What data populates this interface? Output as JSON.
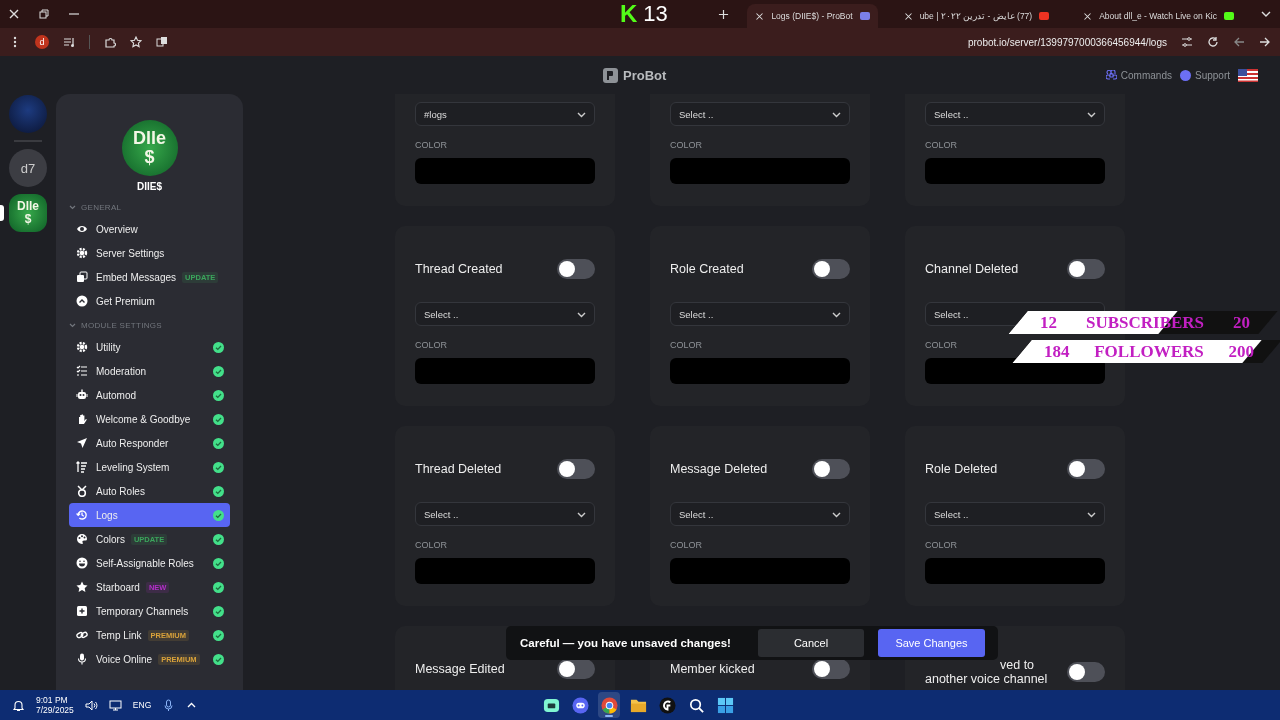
{
  "kick_overlay": {
    "logo": "K",
    "count": "13"
  },
  "tabs": [
    {
      "title": "Logs (DIIE$) - ProBot",
      "selected": true
    },
    {
      "title": "(77) عايض - تدرين ٢٠٢٢ | ube",
      "selected": false
    },
    {
      "title": "About dll_e - Watch Live on Kic",
      "selected": false
    }
  ],
  "toolbar": {
    "profile_initial": "d",
    "url": "probot.io/server/1399797000366456944/logs"
  },
  "header": {
    "brand": "ProBot",
    "links": [
      "Commands",
      "Support"
    ]
  },
  "servers": [
    {
      "kind": "photo",
      "selected": false
    },
    {
      "kind": "initials",
      "label": "d7",
      "selected": false
    },
    {
      "kind": "logo",
      "label": "Dlle $",
      "selected": true
    }
  ],
  "server": {
    "logo_text": "Dlle $",
    "name": "DIIE$"
  },
  "sidebar": {
    "sections": [
      {
        "title": "GENERAL",
        "expanded": true,
        "items": [
          {
            "label": "Overview",
            "selected": false
          },
          {
            "label": "Server Settings",
            "selected": false
          },
          {
            "label": "Embed Messages",
            "badge": {
              "text": "UPDATE",
              "color": "#3ba55c"
            },
            "selected": false
          },
          {
            "label": "Get Premium",
            "selected": false
          }
        ]
      },
      {
        "title": "MODULE SETTINGS",
        "expanded": true,
        "items": [
          {
            "label": "Utility",
            "enabled": true,
            "selected": false
          },
          {
            "label": "Moderation",
            "enabled": true,
            "selected": false
          },
          {
            "label": "Automod",
            "enabled": true,
            "selected": false
          },
          {
            "label": "Welcome & Goodbye",
            "enabled": true,
            "selected": false
          },
          {
            "label": "Auto Responder",
            "enabled": true,
            "selected": false
          },
          {
            "label": "Leveling System",
            "enabled": true,
            "selected": false
          },
          {
            "label": "Auto Roles",
            "enabled": true,
            "selected": false
          },
          {
            "label": "Logs",
            "enabled": true,
            "selected": true
          },
          {
            "label": "Colors",
            "badge": {
              "text": "UPDATE",
              "color": "#3ba55c"
            },
            "enabled": true,
            "selected": false
          },
          {
            "label": "Self-Assignable Roles",
            "enabled": true,
            "selected": false
          },
          {
            "label": "Starboard",
            "badge": {
              "text": "NEW",
              "color": "#b22fc8"
            },
            "enabled": true,
            "selected": false
          },
          {
            "label": "Temporary Channels",
            "enabled": true,
            "selected": false
          },
          {
            "label": "Temp Link",
            "badge": {
              "text": "PREMIUM",
              "color": "#d9a23a"
            },
            "enabled": true,
            "selected": false
          },
          {
            "label": "Voice Online",
            "badge": {
              "text": "PREMIUM",
              "color": "#d9a23a"
            },
            "enabled": true,
            "selected": false
          }
        ]
      }
    ]
  },
  "log_cards": [
    {
      "channel": "#logs",
      "color_label": "COLOR"
    },
    {
      "channel": "Select ..",
      "color_label": "COLOR"
    },
    {
      "channel": "Select ..",
      "color_label": "COLOR"
    },
    {
      "title": "Thread Created",
      "on": false,
      "channel": "Select ..",
      "color_label": "COLOR"
    },
    {
      "title": "Role Created",
      "on": false,
      "channel": "Select ..",
      "color_label": "COLOR"
    },
    {
      "title": "Channel Deleted",
      "on": false,
      "channel": "Select ..",
      "color_label": "COLOR"
    },
    {
      "title": "Thread Deleted",
      "on": false,
      "channel": "Select ..",
      "color_label": "COLOR"
    },
    {
      "title": "Message Deleted",
      "on": false,
      "channel": "Select ..",
      "color_label": "COLOR"
    },
    {
      "title": "Role Deleted",
      "on": false,
      "channel": "Select ..",
      "color_label": "COLOR"
    },
    {
      "title": "Message Edited",
      "on": false
    },
    {
      "title": "Member kicked",
      "on": false
    },
    {
      "title": "ved to another voice channel",
      "on": false
    }
  ],
  "toast": {
    "message": "Careful — you have unsaved changes!",
    "buttons": [
      {
        "label": "Cancel",
        "kind": "secondary"
      },
      {
        "label": "Save Changes",
        "kind": "primary"
      }
    ]
  },
  "stream_goals": [
    {
      "count": "12",
      "label": "SUBSCRIBERS",
      "goal": "20",
      "level": 0.6
    },
    {
      "count": "184",
      "label": "FOLLOWERS",
      "goal": "200",
      "level": 0.92
    }
  ],
  "taskbar": {
    "time": "9:01 PM",
    "date": "7/29/2025",
    "language": "ENG",
    "apps": [
      {
        "kind": "stream",
        "selected": false
      },
      {
        "kind": "chat",
        "selected": false
      },
      {
        "kind": "browser",
        "selected": true
      },
      {
        "kind": "folder",
        "selected": false
      },
      {
        "kind": "gaming",
        "selected": false
      },
      {
        "kind": "search",
        "selected": false
      },
      {
        "kind": "start",
        "selected": false
      }
    ]
  }
}
